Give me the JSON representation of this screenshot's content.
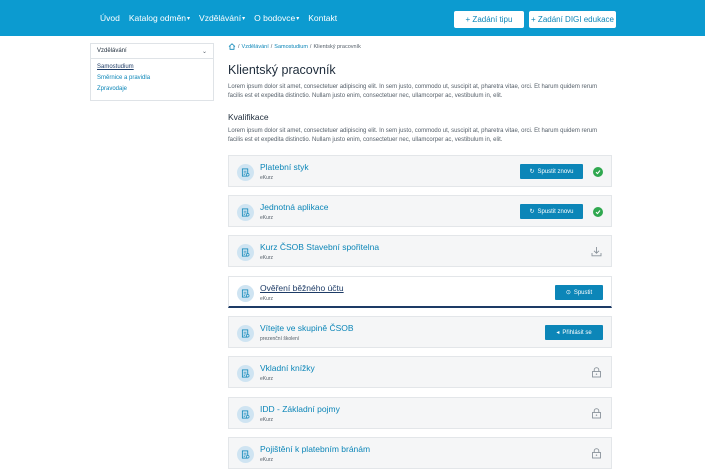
{
  "nav": {
    "items": [
      "Úvod",
      "Katalog odměn",
      "Vzdělávání",
      "O bodovce",
      "Kontakt"
    ],
    "caret_items": [
      false,
      true,
      true,
      true,
      false
    ],
    "btn_tip": "+ Zadání tipu",
    "btn_digi": "+ Zadání DIGI edukace"
  },
  "sidebar": {
    "select": "Vzdělávání",
    "items": [
      "Samostudium",
      "Směrnice a pravidla",
      "Zpravodaje"
    ]
  },
  "breadcrumb": {
    "sep": "/",
    "items": [
      "Vzdělávání",
      "Samostudium",
      "Klientský pracovník"
    ]
  },
  "page": {
    "title": "Klientský pracovník",
    "lead": "Lorem ipsum dolor sit amet, consectetuer adipiscing elit. In sem justo, commodo ut, suscipit at, pharetra vitae, orci. Et harum quidem rerum facilis est et expedita distinctio. Nullam justo enim, consectetuer nec, ullamcorper ac, vestibulum in, elit.",
    "section": "Kvalifikace",
    "lead2": "Lorem ipsum dolor sit amet, consectetuer adipiscing elit. In sem justo, commodo ut, suscipit at, pharetra vitae, orci. Et harum quidem rerum facilis est et expedita distinctio. Nullam justo enim, consectetuer nec, ullamcorper ac, vestibulum in, elit."
  },
  "courses": [
    {
      "title": "Platební styk",
      "sub": "eKurz",
      "action": "Spustit znovu",
      "status": "completed"
    },
    {
      "title": "Jednotná aplikace",
      "sub": "eKurz",
      "action": "Spustit znovu",
      "status": "completed"
    },
    {
      "title": "Kurz ČSOB Stavební spořitelna",
      "sub": "eKurz",
      "action": "",
      "status": "download"
    },
    {
      "title": "Ověření běžného účtu",
      "sub": "eKurz",
      "action": "Spustit",
      "status": "active"
    },
    {
      "title": "Vítejte ve skupině ČSOB",
      "sub": "prezenční školení",
      "action": "Přihlásit se",
      "status": "signup"
    },
    {
      "title": "Vkladní knížky",
      "sub": "eKurz",
      "action": "",
      "status": "locked"
    },
    {
      "title": "IDD - Základní pojmy",
      "sub": "eKurz",
      "action": "",
      "status": "locked"
    },
    {
      "title": "Pojištění k platebním bránám",
      "sub": "eKurz",
      "action": "",
      "status": "locked"
    }
  ],
  "colors": {
    "brand": "#0c9bd0",
    "accent": "#0c86b8",
    "dark": "#1d3b66",
    "success": "#2fa84f"
  }
}
